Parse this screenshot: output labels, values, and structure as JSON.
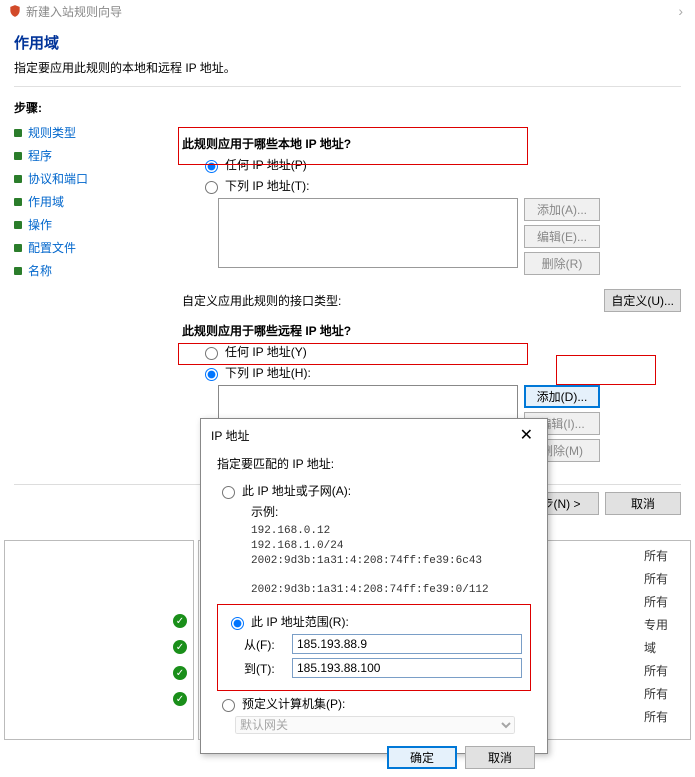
{
  "titlebar": {
    "title": "新建入站规则向导"
  },
  "header": {
    "title": "作用域",
    "subtitle": "指定要应用此规则的本地和远程 IP 地址。"
  },
  "steps": {
    "label": "步骤:",
    "items": [
      {
        "label": "规则类型"
      },
      {
        "label": "程序"
      },
      {
        "label": "协议和端口"
      },
      {
        "label": "作用域"
      },
      {
        "label": "操作"
      },
      {
        "label": "配置文件"
      },
      {
        "label": "名称"
      }
    ]
  },
  "main": {
    "localGroup": "此规则应用于哪些本地 IP 地址?",
    "localAny": "任何 IP 地址(P)",
    "localThese": "下列 IP 地址(T):",
    "addA": "添加(A)...",
    "editE": "编辑(E)...",
    "removeR": "删除(R)",
    "ifaceLabel": "自定义应用此规则的接口类型:",
    "ifaceBtn": "自定义(U)...",
    "remoteGroup": "此规则应用于哪些远程 IP 地址?",
    "remoteAny": "任何 IP 地址(Y)",
    "remoteThese": "下列 IP 地址(H):",
    "addD": "添加(D)...",
    "editI": "编辑(I)...",
    "removeM": "删除(M)",
    "next": "步(N) >",
    "cancel": "取消"
  },
  "ipDialog": {
    "title": "IP 地址",
    "subtitle": "指定要匹配的 IP 地址:",
    "optSubnet": "此 IP 地址或子网(A):",
    "exampleLabel": "示例:",
    "exampleLines": "192.168.0.12\n192.168.1.0/24\n2002:9d3b:1a31:4:208:74ff:fe39:6c43\n\n2002:9d3b:1a31:4:208:74ff:fe39:0/112",
    "optRange": "此 IP 地址范围(R):",
    "fromLabel": "从(F):",
    "fromValue": "185.193.88.9",
    "toLabel": "到(T):",
    "toValue": "185.193.88.100",
    "optPredef": "预定义计算机集(P):",
    "predefValue": "默认网关",
    "ok": "确定",
    "cancel": "取消"
  },
  "gridRight": [
    "所有",
    "所有",
    "所有",
    "专用",
    "域",
    "所有",
    "所有",
    "所有"
  ]
}
